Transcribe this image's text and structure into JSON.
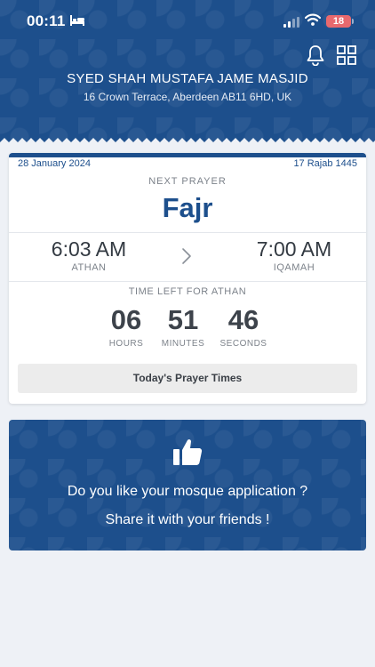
{
  "status_bar": {
    "time": "00:11",
    "battery_level": "18",
    "icons": [
      "bed-icon",
      "signal-icon",
      "wifi-icon",
      "battery-icon"
    ]
  },
  "header": {
    "mosque_name": "SYED SHAH MUSTAFA JAME MASJID",
    "address": "16 Crown Terrace, Aberdeen AB11 6HD, UK",
    "icons": [
      "bell-icon",
      "grid-icon"
    ],
    "color": "#1d4f8c"
  },
  "prayer_card": {
    "gregorian_date": "28 January 2024",
    "hijri_date": "17 Rajab 1445",
    "next_label": "NEXT PRAYER",
    "prayer_name": "Fajr",
    "athan_time": "6:03 AM",
    "athan_label": "ATHAN",
    "iqamah_time": "7:00 AM",
    "iqamah_label": "IQAMAH",
    "time_left_label": "TIME LEFT FOR ATHAN",
    "countdown": {
      "hours": "06",
      "hours_label": "HOURS",
      "minutes": "51",
      "minutes_label": "MINUTES",
      "seconds": "46",
      "seconds_label": "SECONDS"
    },
    "today_button": "Today's Prayer Times"
  },
  "share_card": {
    "line1": "Do you like your mosque application ?",
    "line2": "Share it with your friends !",
    "icon": "thumbs-up-icon"
  },
  "colors": {
    "brand_blue": "#1d4f8c",
    "background": "#eef1f6",
    "battery_red": "#e8696e"
  }
}
